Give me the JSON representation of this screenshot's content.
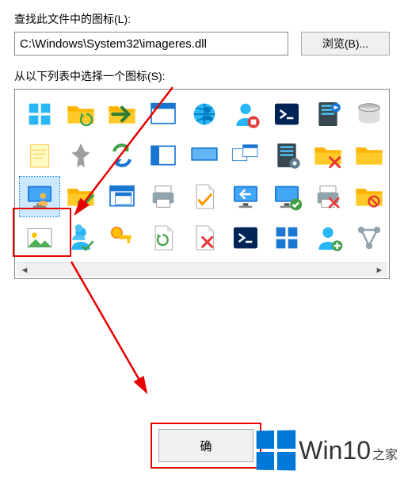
{
  "labels": {
    "find_icon": "查找此文件中的图标(L):",
    "select_icon": "从以下列表中选择一个图标(S):"
  },
  "path_input": {
    "value": "C:\\Windows\\System32\\imageres.dll"
  },
  "buttons": {
    "browse": "浏览(B)...",
    "ok": "确"
  },
  "watermark": {
    "brand": "Win10",
    "suffix": "之家"
  },
  "icons": {
    "selected_index": 18,
    "grid": [
      "tiles",
      "refresh",
      "folder-open",
      "window",
      "network-user",
      "user-stop",
      "powershell",
      "server-media",
      "disk",
      "note",
      "pin",
      "arrows-sync",
      "layout",
      "desktop-wide",
      "multi-window",
      "server-settings",
      "folder-delete",
      "folder-yellow",
      "monitor-user",
      "folder-check",
      "windows",
      "printer",
      "file-check",
      "monitor-arrow",
      "monitor-ok",
      "printer-delete",
      "folder-block",
      "picture",
      "users-check",
      "key",
      "file-rotate",
      "file-delete",
      "powershell2",
      "tiles-blue",
      "user-add",
      "network"
    ]
  }
}
